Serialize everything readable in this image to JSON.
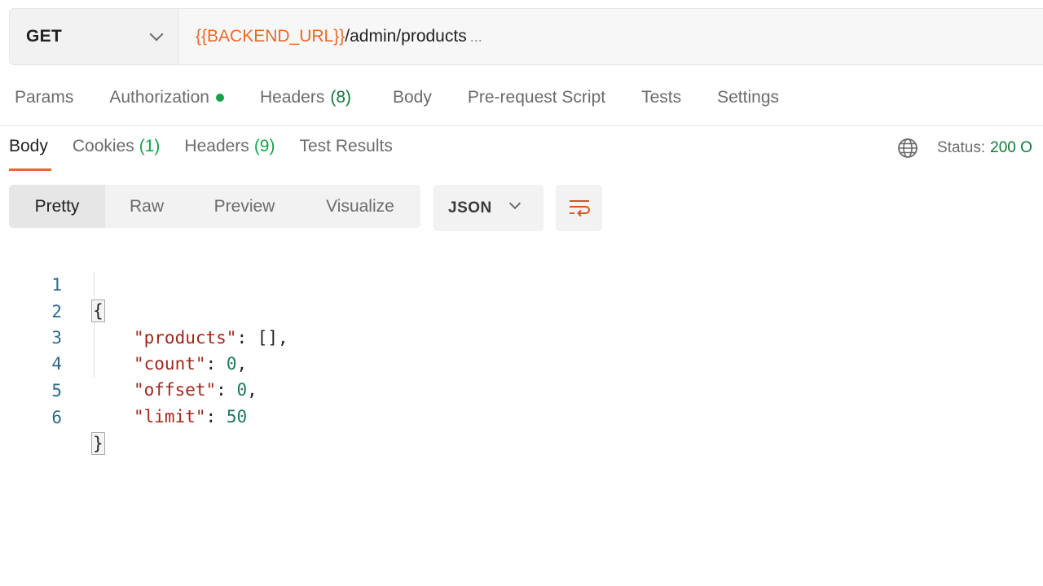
{
  "request": {
    "method": "GET",
    "url_variable": "{{BACKEND_URL}}",
    "url_path": "/admin/products",
    "url_ellipsis": "..."
  },
  "request_tabs": [
    {
      "label": "Params"
    },
    {
      "label": "Authorization"
    },
    {
      "label": "Headers",
      "count": "(8)"
    },
    {
      "label": "Body"
    },
    {
      "label": "Pre-request Script"
    },
    {
      "label": "Tests"
    },
    {
      "label": "Settings"
    }
  ],
  "response_tabs": [
    {
      "label": "Body"
    },
    {
      "label": "Cookies",
      "count": "(1)"
    },
    {
      "label": "Headers",
      "count": "(9)"
    },
    {
      "label": "Test Results"
    }
  ],
  "status": {
    "label": "Status:",
    "value": "200 O"
  },
  "format_buttons": [
    "Pretty",
    "Raw",
    "Preview",
    "Visualize"
  ],
  "language": "JSON",
  "icons": {
    "globe": "globe-icon",
    "wrap": "wrap-lines-icon",
    "dropdown": "chevron-down-icon"
  },
  "code": {
    "line_numbers": [
      "1",
      "2",
      "3",
      "4",
      "5",
      "6"
    ],
    "open_brace": "{",
    "close_brace": "}",
    "entries": [
      {
        "key": "\"products\"",
        "value": "[]",
        "trail": ","
      },
      {
        "key": "\"count\"",
        "value": "0",
        "trail": ","
      },
      {
        "key": "\"offset\"",
        "value": "0",
        "trail": ","
      },
      {
        "key": "\"limit\"",
        "value": "50",
        "trail": ""
      }
    ]
  },
  "colors": {
    "accent": "#e86a2a",
    "success": "#107a3a",
    "json_key": "#a1261b",
    "json_number": "#1c7a5a"
  }
}
